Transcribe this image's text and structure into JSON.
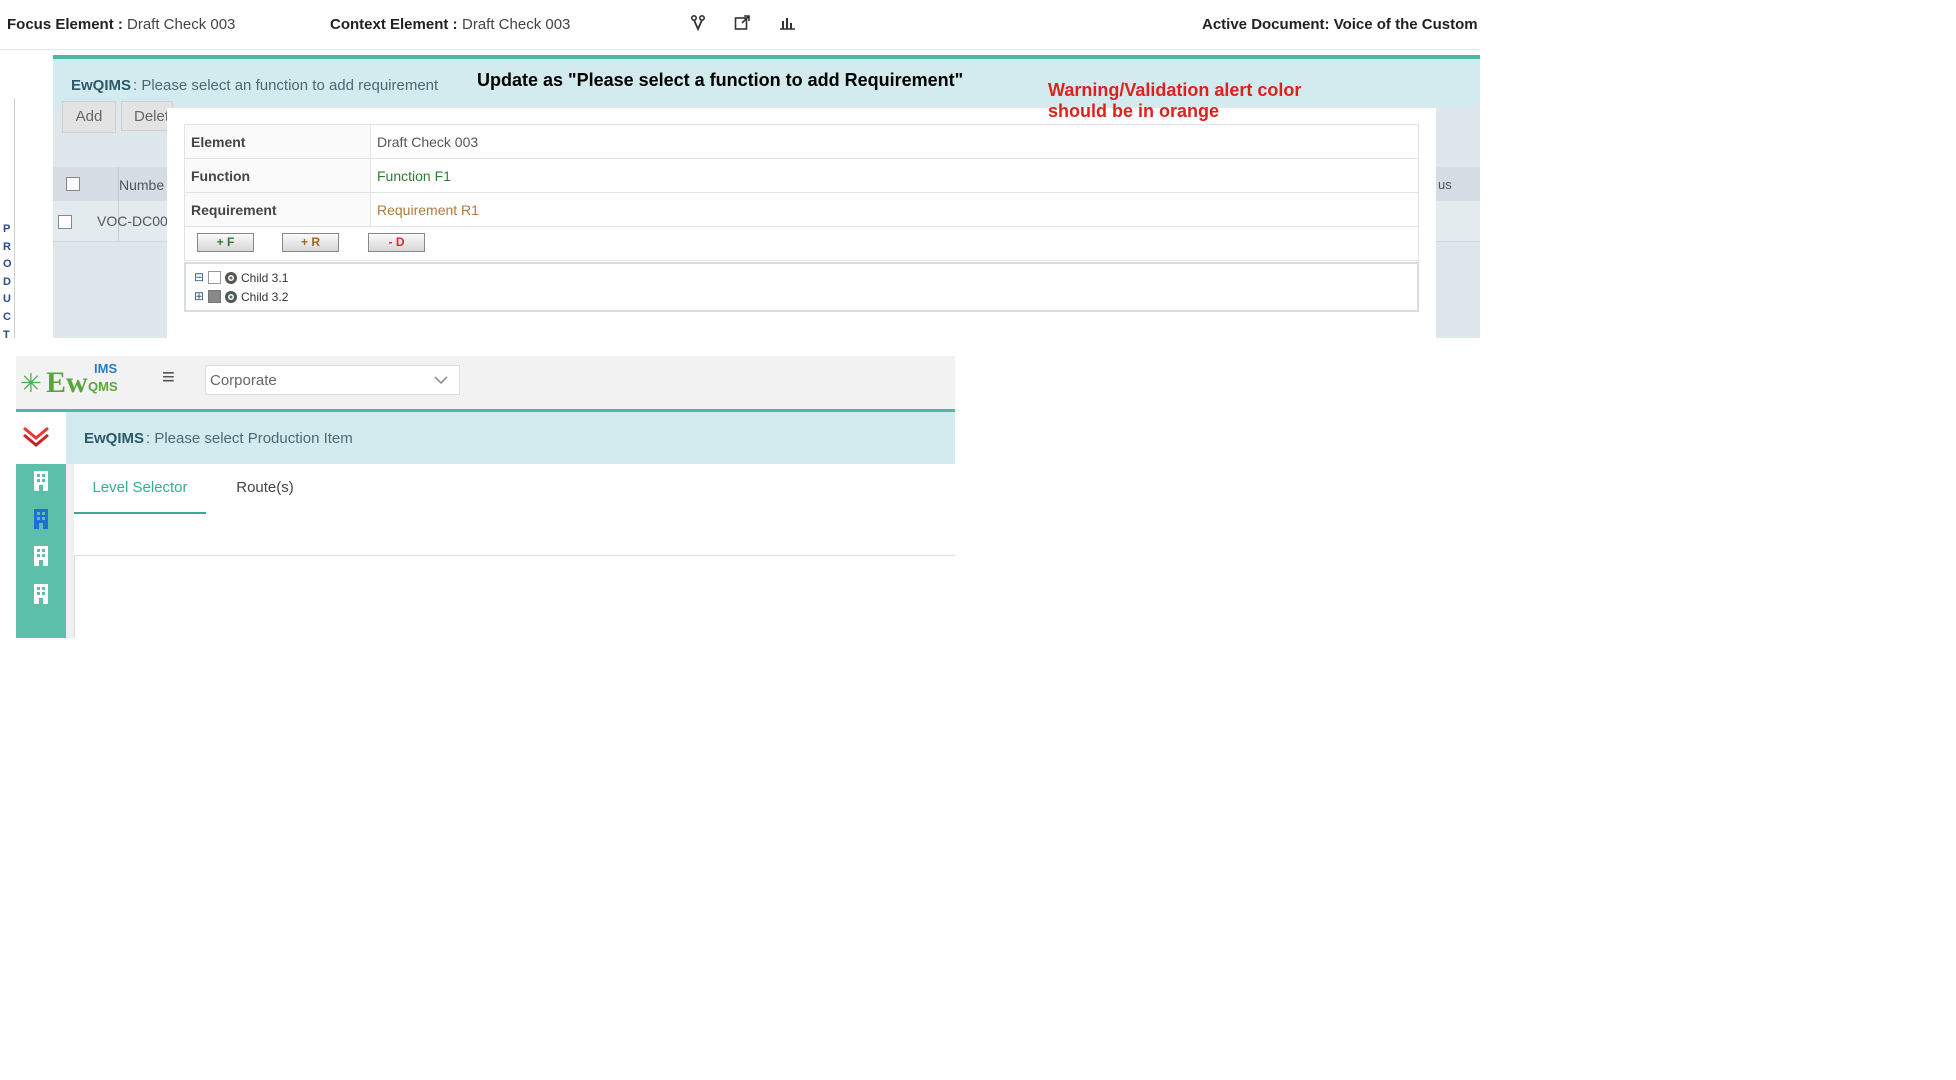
{
  "topbar": {
    "focus_label": "Focus Element :",
    "focus_value": "Draft Check 003",
    "context_label": "Context Element :",
    "context_value": "Draft Check 003",
    "active_doc": "Active Document: Voice of the Custome"
  },
  "side_vertical_text": "PRODUCT",
  "upper": {
    "brand": "EwQIMS",
    "message": " : Please select an function to add requirement",
    "toolbar": {
      "add_label": "Add",
      "delete_label": "Delet"
    },
    "grid": {
      "number_header": "Numbe",
      "status_header": "us",
      "row_number": "VOC-DC00"
    }
  },
  "detail": {
    "rows": [
      {
        "key": "Element",
        "value": "Draft Check 003",
        "color": "#555555"
      },
      {
        "key": "Function",
        "value": "Function F1",
        "color": "#2e7d32"
      },
      {
        "key": "Requirement",
        "value": "Requirement R1",
        "color": "#b07a3c"
      }
    ],
    "buttons": {
      "add_function": "+ F",
      "add_requirement": "+ R",
      "delete": "- D"
    },
    "tree": [
      {
        "expander": "⊟",
        "label": "Child 3.1"
      },
      {
        "expander": "⊞",
        "label": "Child 3.2"
      }
    ]
  },
  "annotations": {
    "update_note": "Update as \"Please select a function to add Requirement\"",
    "warning_line1": "Warning/Validation alert color",
    "warning_line2": "should be in orange"
  },
  "lower": {
    "logo_main": "Ew",
    "logo_top": "IMS",
    "logo_bottom": "QMS",
    "org_select": "Corporate",
    "brand": "EwQIMS",
    "message": " : Please select Production Item",
    "tabs": [
      {
        "label": "Level Selector",
        "active": true
      },
      {
        "label": "Route(s)",
        "active": false
      }
    ]
  },
  "colors": {
    "teal_accent": "#4db6a4",
    "message_bar": "#d3eaee",
    "annotation_red": "#e0201e",
    "tab_active": "#3aaa95"
  }
}
